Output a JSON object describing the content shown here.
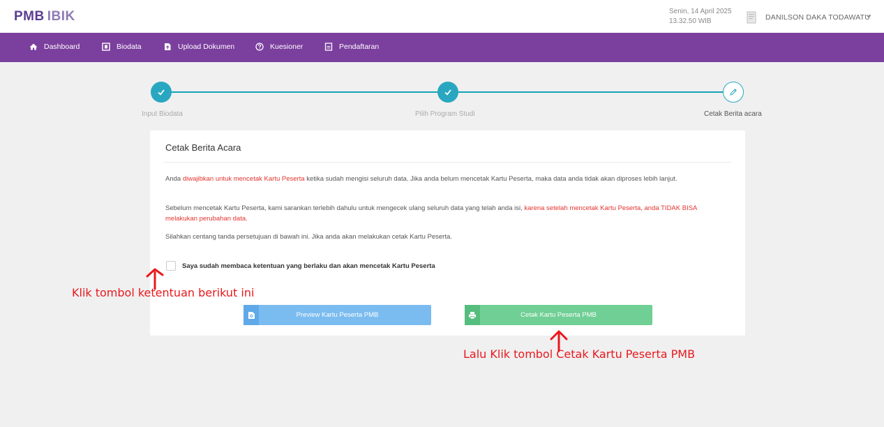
{
  "header": {
    "logo_main": "PMB",
    "logo_sub": "IBIK",
    "date": "Senin, 14 April 2025",
    "time": "13.32.50 WIB",
    "user_name": "DANILSON DAKA TODAWATU"
  },
  "nav": [
    {
      "label": "Dashboard",
      "icon": "home-icon"
    },
    {
      "label": "Biodata",
      "icon": "id-card-icon"
    },
    {
      "label": "Upload Dokumen",
      "icon": "upload-file-icon"
    },
    {
      "label": "Kuesioner",
      "icon": "question-circle-icon"
    },
    {
      "label": "Pendaftaran",
      "icon": "document-icon"
    }
  ],
  "stepper": [
    {
      "label": "Input Biodata",
      "status": "done"
    },
    {
      "label": "Pilih Program Studi",
      "status": "done"
    },
    {
      "label": "Cetak Berita acara",
      "status": "current"
    }
  ],
  "card": {
    "title": "Cetak Berita Acara",
    "p1_a": "Anda ",
    "p1_red": "diwajibkan untuk mencetak Kartu Peserta",
    "p1_b": " ketika sudah mengisi seluruh data. Jika anda belum mencetak Kartu Peserta, maka data anda tidak akan diproses lebih lanjut.",
    "p2_a": "Sebelum mencetak Kartu Peserta, kami sarankan terlebih dahulu untuk mengecek ulang seluruh data yang telah anda isi, ",
    "p2_red": "karena setelah mencetak Kartu Peserta, anda TIDAK BISA melakukan perubahan data.",
    "p3": "Silahkan centang tanda persetujuan di bawah ini. Jika anda akan melakukan cetak Kartu Peserta.",
    "checkbox_label": "Saya sudah membaca ketentuan yang berlaku dan akan mencetak Kartu Peserta",
    "preview_button": "Preview Kartu Peserta PMB",
    "print_button": "Cetak Kartu Peserta PMB"
  },
  "annotations": {
    "a1": "Klik tombol ketentuan berikut ini",
    "a2": "Lalu Klik tombol Cetak Kartu  Peserta PMB"
  },
  "colors": {
    "nav_bg": "#7b3f9e",
    "step": "#2aa7c0",
    "preview_btn": "#7bbcf0",
    "print_btn": "#6fcf94",
    "annotation": "#e8191c"
  }
}
